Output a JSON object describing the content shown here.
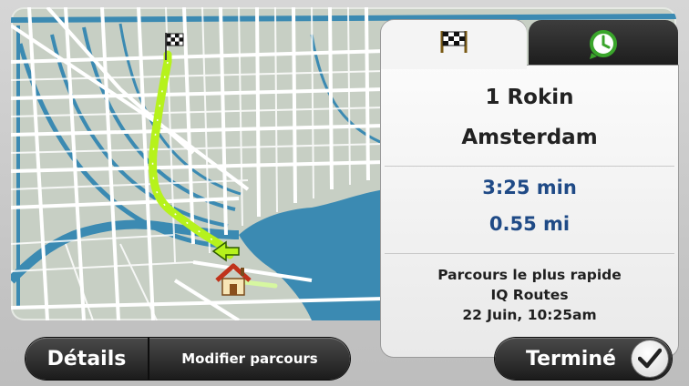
{
  "colors": {
    "route": "#b6f21c",
    "water": "#3b8ab2",
    "street": "#ffffff",
    "block": "#c7cfc4",
    "stat_text": "#1f4a86"
  },
  "map": {
    "destination_marker": "checkered-flag-icon",
    "start_marker": "home-icon",
    "direction_marker": "arrow-icon"
  },
  "panel": {
    "tabs": [
      {
        "name": "destination",
        "icon": "checkered-flag-icon",
        "active": true
      },
      {
        "name": "time",
        "icon": "clock-icon",
        "active": false
      }
    ],
    "address_line1": "1 Rokin",
    "address_line2": "Amsterdam",
    "travel_time": "3:25 min",
    "distance": "0.55 mi",
    "route_type": "Parcours le plus rapide",
    "routing_tech": "IQ Routes",
    "arrival": "22 Juin, 10:25am"
  },
  "buttons": {
    "details": "Détails",
    "modify_route": "Modifier parcours",
    "done": "Terminé",
    "done_icon": "checkmark-icon"
  }
}
